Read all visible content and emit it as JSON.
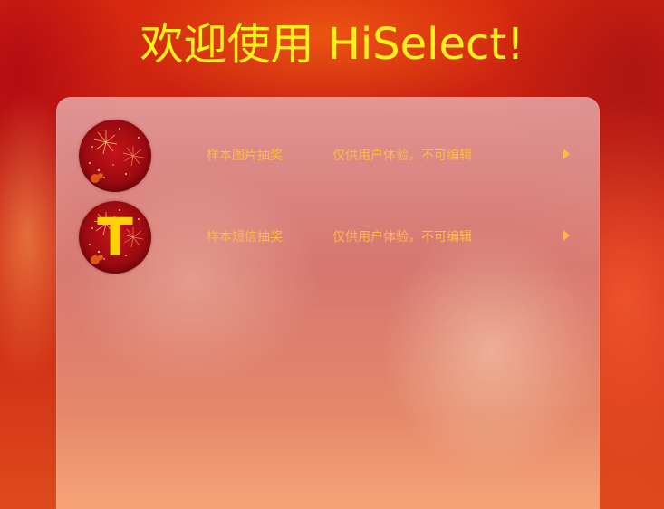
{
  "header": {
    "title": "欢迎使用 HiSelect!"
  },
  "colors": {
    "title": "#fff21a",
    "row_text": "#ffb84a",
    "avatar_letter": "#ffcf0a"
  },
  "lottery_list": {
    "items": [
      {
        "name": "样本图片抽奖",
        "description": "仅供用户体验，不可编辑",
        "avatar_icon": "fireworks-icon",
        "avatar_letter": ""
      },
      {
        "name": "样本短信抽奖",
        "description": "仅供用户体验，不可编辑",
        "avatar_icon": "fireworks-icon",
        "avatar_letter": "T"
      }
    ]
  }
}
